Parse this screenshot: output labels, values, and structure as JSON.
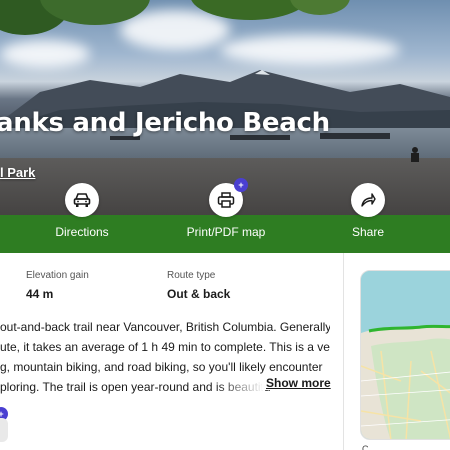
{
  "hero": {
    "title": "anks and Jericho Beach",
    "subtitle": "l Park"
  },
  "actions": [
    {
      "label": "Directions",
      "icon": "car-icon"
    },
    {
      "label": "Print/PDF map",
      "icon": "printer-icon",
      "badge": "+"
    },
    {
      "label": "Share",
      "icon": "share-arrow-icon"
    }
  ],
  "stats": {
    "elevation_label": "Elevation gain",
    "elevation_value": "44 m",
    "route_label": "Route type",
    "route_value": "Out & back"
  },
  "description": {
    "lines": [
      "out-and-back trail near Vancouver, British Columbia. Generally",
      "ute, it takes an average of 1 h 49 min to complete. This is a very",
      "g, mountain biking, and road biking, so you'll likely encounter",
      "ploring. The trail is open year-round and is beautifu"
    ],
    "show_more": "Show more"
  },
  "map": {
    "label": "C",
    "water_color": "#9bd3dc",
    "park_color": "#cfe5c4",
    "trail_color": "#2fb52f"
  },
  "colors": {
    "brand_green": "#2e7d22",
    "plus_purple": "#4a3fd1"
  }
}
